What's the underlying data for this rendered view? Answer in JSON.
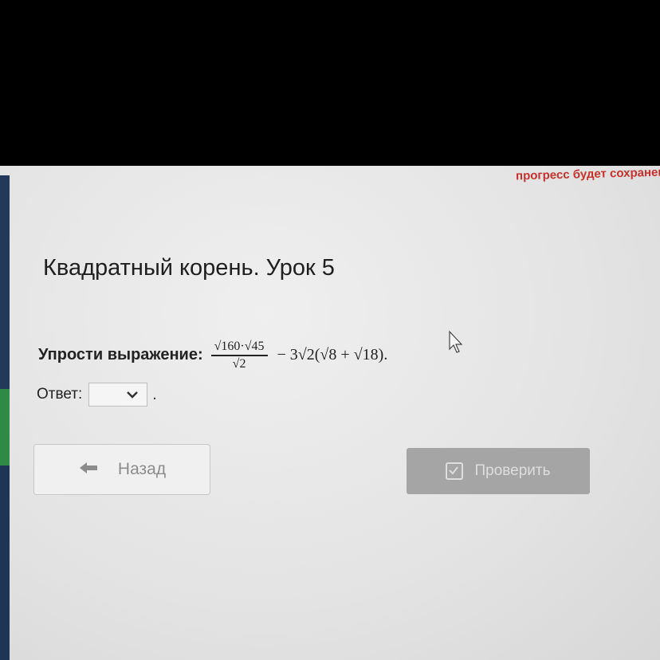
{
  "header": {
    "progress_note": "прогресс будет сохранен"
  },
  "lesson": {
    "title": "Квадратный корень. Урок 5"
  },
  "task": {
    "label": "Упрости выражение:",
    "numerator": "√160·√45",
    "denominator": "√2",
    "rest": "− 3√2(√8 + √18)."
  },
  "answer": {
    "label": "Ответ:",
    "selected": "",
    "suffix": "."
  },
  "buttons": {
    "back": "Назад",
    "check": "Проверить"
  },
  "icons": {
    "back": "arrow-left-icon",
    "dropdown": "chevron-down-icon",
    "check": "checkbox-icon",
    "cursor": "mouse-pointer-icon"
  },
  "colors": {
    "progress_note": "#c8312b",
    "check_button_disabled": "#a5a5a5",
    "left_strip_blue": "#23395a",
    "left_strip_green": "#2f8a46"
  }
}
